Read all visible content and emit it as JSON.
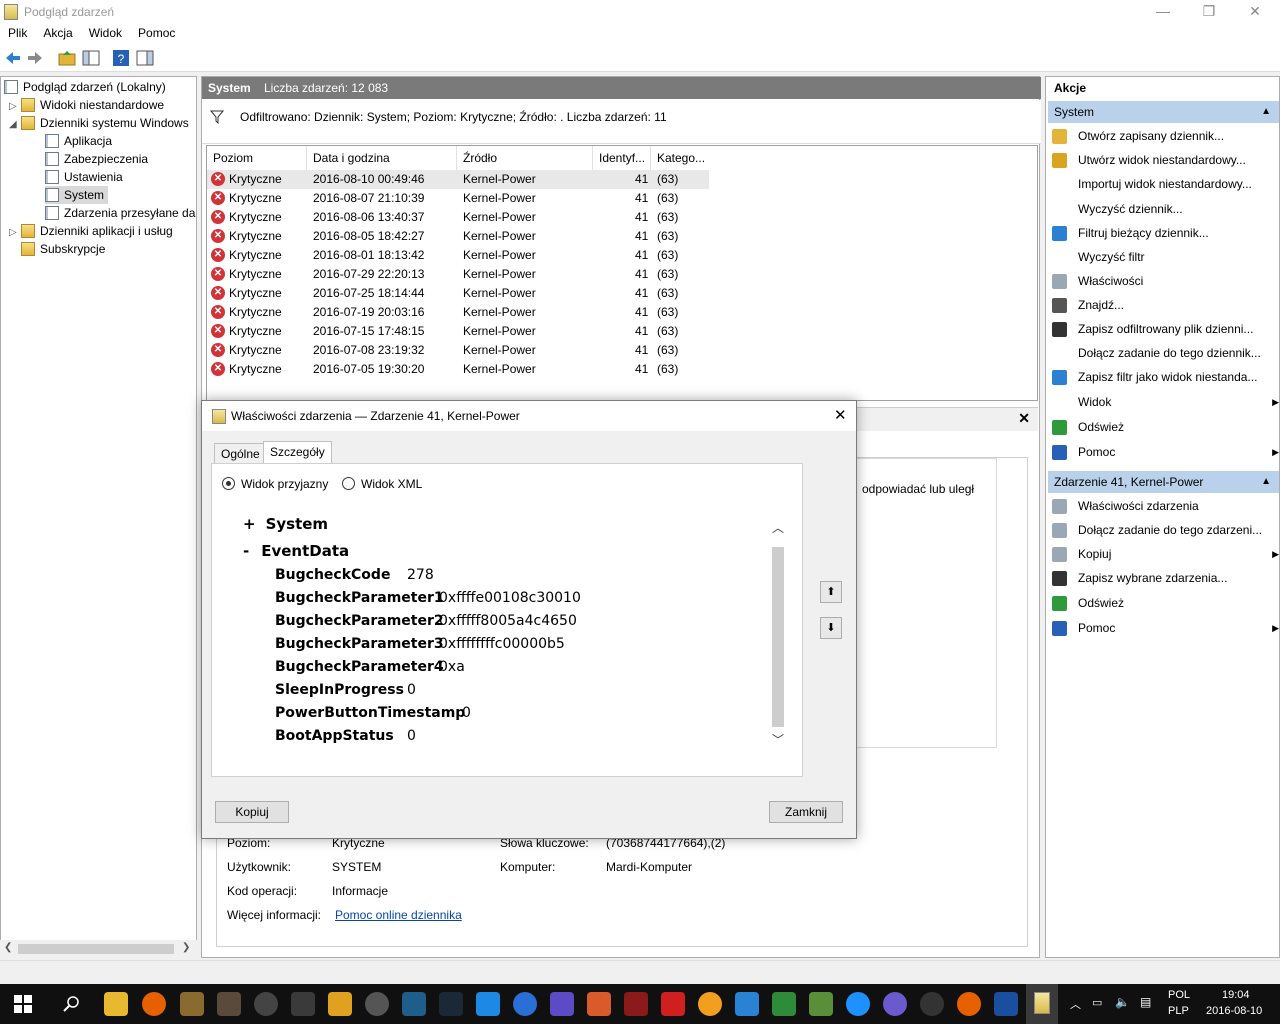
{
  "window": {
    "title": "Podgląd zdarzeń",
    "controls": [
      "—",
      "❐",
      "✕"
    ]
  },
  "menu": [
    "Plik",
    "Akcja",
    "Widok",
    "Pomoc"
  ],
  "tree": {
    "root": "Podgląd zdarzeń (Lokalny)",
    "items": [
      {
        "label": "Widoki niestandardowe"
      },
      {
        "label": "Dzienniki systemu Windows"
      },
      {
        "label": "Aplikacja"
      },
      {
        "label": "Zabezpieczenia"
      },
      {
        "label": "Ustawienia"
      },
      {
        "label": "System"
      },
      {
        "label": "Zdarzenia przesyłane dalej"
      },
      {
        "label": "Dzienniki aplikacji i usług"
      },
      {
        "label": "Subskrypcje"
      }
    ]
  },
  "center": {
    "log_name": "System",
    "count_label": "Liczba zdarzeń: 12 083",
    "filter_text": "Odfiltrowano: Dziennik: System; Poziom: Krytyczne; Źródło: . Liczba zdarzeń: 11",
    "columns": [
      "Poziom",
      "Data i godzina",
      "Źródło",
      "Identyf...",
      "Katego..."
    ],
    "rows": [
      {
        "level": "Krytyczne",
        "date": "2016-08-10 00:49:46",
        "source": "Kernel-Power",
        "id": "41",
        "cat": "(63)"
      },
      {
        "level": "Krytyczne",
        "date": "2016-08-07 21:10:39",
        "source": "Kernel-Power",
        "id": "41",
        "cat": "(63)"
      },
      {
        "level": "Krytyczne",
        "date": "2016-08-06 13:40:37",
        "source": "Kernel-Power",
        "id": "41",
        "cat": "(63)"
      },
      {
        "level": "Krytyczne",
        "date": "2016-08-05 18:42:27",
        "source": "Kernel-Power",
        "id": "41",
        "cat": "(63)"
      },
      {
        "level": "Krytyczne",
        "date": "2016-08-01 18:13:42",
        "source": "Kernel-Power",
        "id": "41",
        "cat": "(63)"
      },
      {
        "level": "Krytyczne",
        "date": "2016-07-29 22:20:13",
        "source": "Kernel-Power",
        "id": "41",
        "cat": "(63)"
      },
      {
        "level": "Krytyczne",
        "date": "2016-07-25 18:14:44",
        "source": "Kernel-Power",
        "id": "41",
        "cat": "(63)"
      },
      {
        "level": "Krytyczne",
        "date": "2016-07-19 20:03:16",
        "source": "Kernel-Power",
        "id": "41",
        "cat": "(63)"
      },
      {
        "level": "Krytyczne",
        "date": "2016-07-15 17:48:15",
        "source": "Kernel-Power",
        "id": "41",
        "cat": "(63)"
      },
      {
        "level": "Krytyczne",
        "date": "2016-07-08 23:19:32",
        "source": "Kernel-Power",
        "id": "41",
        "cat": "(63)"
      },
      {
        "level": "Krytyczne",
        "date": "2016-07-05 19:30:20",
        "source": "Kernel-Power",
        "id": "41",
        "cat": "(63)"
      }
    ],
    "preview_text": "odpowiadać lub uległ",
    "general": {
      "level_label": "Poziom:",
      "level": "Krytyczne",
      "keywords_label": "Słowa kluczowe:",
      "keywords": "(70368744177664),(2)",
      "user_label": "Użytkownik:",
      "user": "SYSTEM",
      "computer_label": "Komputer:",
      "computer": "Mardi-Komputer",
      "opcode_label": "Kod operacji:",
      "opcode": "Informacje",
      "more_label": "Więcej informacji:",
      "more_link": "Pomoc online dziennika"
    }
  },
  "actions": {
    "header": "Akcje",
    "section1": "System",
    "items1": [
      "Otwórz zapisany dziennik...",
      "Utwórz widok niestandardowy...",
      "Importuj widok niestandardowy...",
      "Wyczyść dziennik...",
      "Filtruj bieżący dziennik...",
      "Wyczyść filtr",
      "Właściwości",
      "Znajdź...",
      "Zapisz odfiltrowany plik dzienni...",
      "Dołącz zadanie do tego dziennik...",
      "Zapisz filtr jako widok niestanda...",
      "Widok",
      "Odśwież",
      "Pomoc"
    ],
    "section2": "Zdarzenie 41, Kernel-Power",
    "items2": [
      "Właściwości zdarzenia",
      "Dołącz zadanie do tego zdarzeni...",
      "Kopiuj",
      "Zapisz wybrane zdarzenia...",
      "Odśwież",
      "Pomoc"
    ]
  },
  "dialog": {
    "title": "Właściwości zdarzenia — Zdarzenie 41, Kernel-Power",
    "tabs": [
      "Ogólne",
      "Szczegóły"
    ],
    "radio_friendly": "Widok przyjazny",
    "radio_xml": "Widok XML",
    "system_node": "System",
    "eventdata_node": "EventData",
    "system_toggle": "+",
    "eventdata_toggle": "-",
    "fields": [
      {
        "k": "BugcheckCode",
        "v": "278"
      },
      {
        "k": "BugcheckParameter1",
        "v": "0xffffe00108c30010"
      },
      {
        "k": "BugcheckParameter2",
        "v": "0xfffff8005a4c4650"
      },
      {
        "k": "BugcheckParameter3",
        "v": "0xffffffffc00000b5"
      },
      {
        "k": "BugcheckParameter4",
        "v": "0xa"
      },
      {
        "k": "SleepInProgress",
        "v": "0"
      },
      {
        "k": "PowerButtonTimestamp",
        "v": "0"
      },
      {
        "k": "BootAppStatus",
        "v": "0"
      }
    ],
    "copy_button": "Kopiuj",
    "close_button": "Zamknij"
  },
  "tray": {
    "lang1": "POL",
    "lang2": "PLP",
    "time": "19:04",
    "date": "2016-08-10"
  }
}
